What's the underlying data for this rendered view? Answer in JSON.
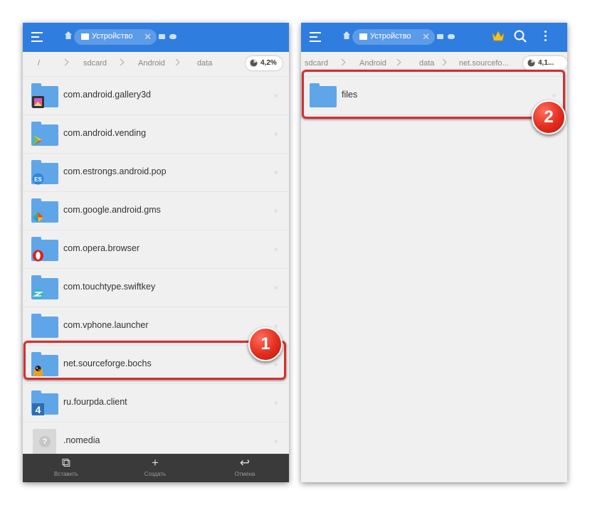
{
  "left": {
    "tab_label": "Устройство",
    "tab_close": "✕",
    "path": [
      "/",
      "sdcard",
      "Android",
      "data"
    ],
    "storage": "4,2%",
    "items": [
      {
        "label": "com.android.gallery3d",
        "icon": "gallery-icon"
      },
      {
        "label": "com.android.vending",
        "icon": "play-store-icon"
      },
      {
        "label": "com.estrongs.android.pop",
        "icon": "es-explorer-icon"
      },
      {
        "label": "com.google.android.gms",
        "icon": "google-play-services-icon"
      },
      {
        "label": "com.opera.browser",
        "icon": "opera-icon"
      },
      {
        "label": "com.touchtype.swiftkey",
        "icon": "swiftkey-icon"
      },
      {
        "label": "com.vphone.launcher",
        "icon": "none"
      },
      {
        "label": "net.sourceforge.bochs",
        "icon": "bochs-icon"
      },
      {
        "label": "ru.fourpda.client",
        "icon": "fourpda-icon"
      },
      {
        "label": ".nomedia",
        "icon": "unknown-file-icon",
        "unknown_glyph": "?"
      }
    ],
    "bottom": [
      {
        "glyph": "⧉",
        "label": "Вставить",
        "icon": "paste-icon"
      },
      {
        "glyph": "+",
        "label": "Создать",
        "icon": "plus-icon"
      },
      {
        "glyph": "↩",
        "label": "Отмена",
        "icon": "undo-icon"
      }
    ],
    "marker": "1"
  },
  "right": {
    "tab_label": "Устройство",
    "tab_close": "✕",
    "path": [
      "sdcard",
      "Android",
      "data",
      "net.sourcefo..."
    ],
    "storage": "4,1...",
    "items": [
      {
        "label": "files",
        "icon": "none"
      }
    ],
    "marker": "2"
  },
  "colors": {
    "appbar": "#2f7ddf",
    "folder": "#5fa6e9",
    "highlight": "#d62d2d",
    "marker": "#e32d1d"
  }
}
